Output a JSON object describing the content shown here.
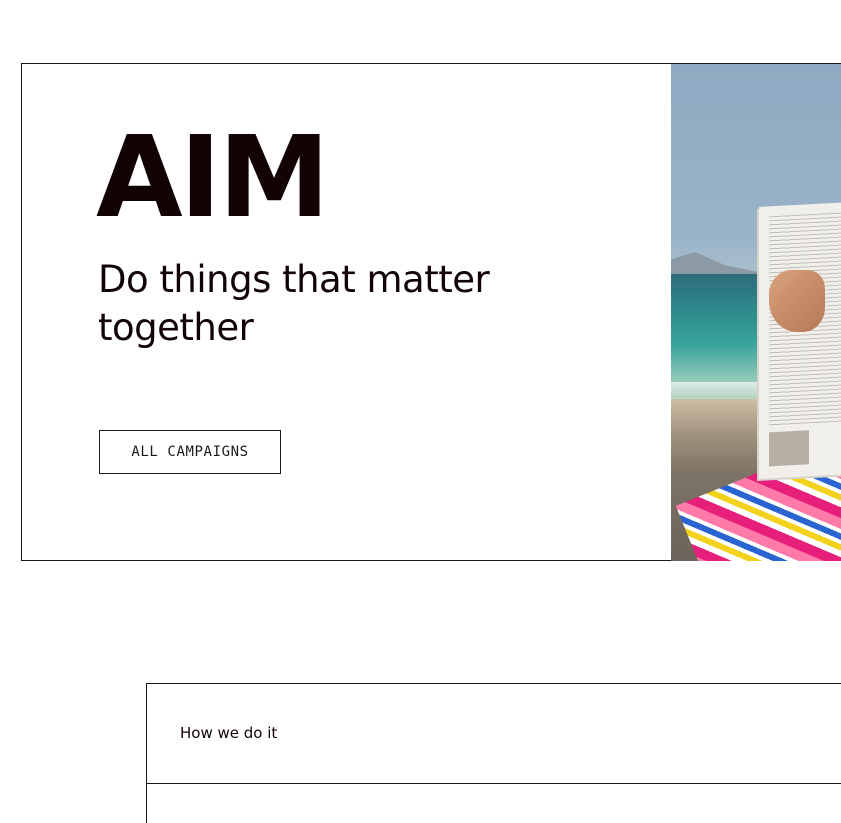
{
  "hero": {
    "title": "AIM",
    "subtitle": "Do things that matter together",
    "button_label": "ALL CAMPAIGNS",
    "image": {
      "subject": "woman-reading-newspaper-on-beach",
      "colors": {
        "sky": "#8fa9c2",
        "sea": "#2e8c8c",
        "sand": "#7e7466",
        "towel_pink": "#e61f7a",
        "towel_yellow": "#f3d21c",
        "towel_blue": "#2a64d1"
      }
    }
  },
  "section": {
    "label": "How we do it"
  },
  "colors": {
    "text": "#120404",
    "border": "#1a1a1a",
    "background": "#ffffff"
  }
}
